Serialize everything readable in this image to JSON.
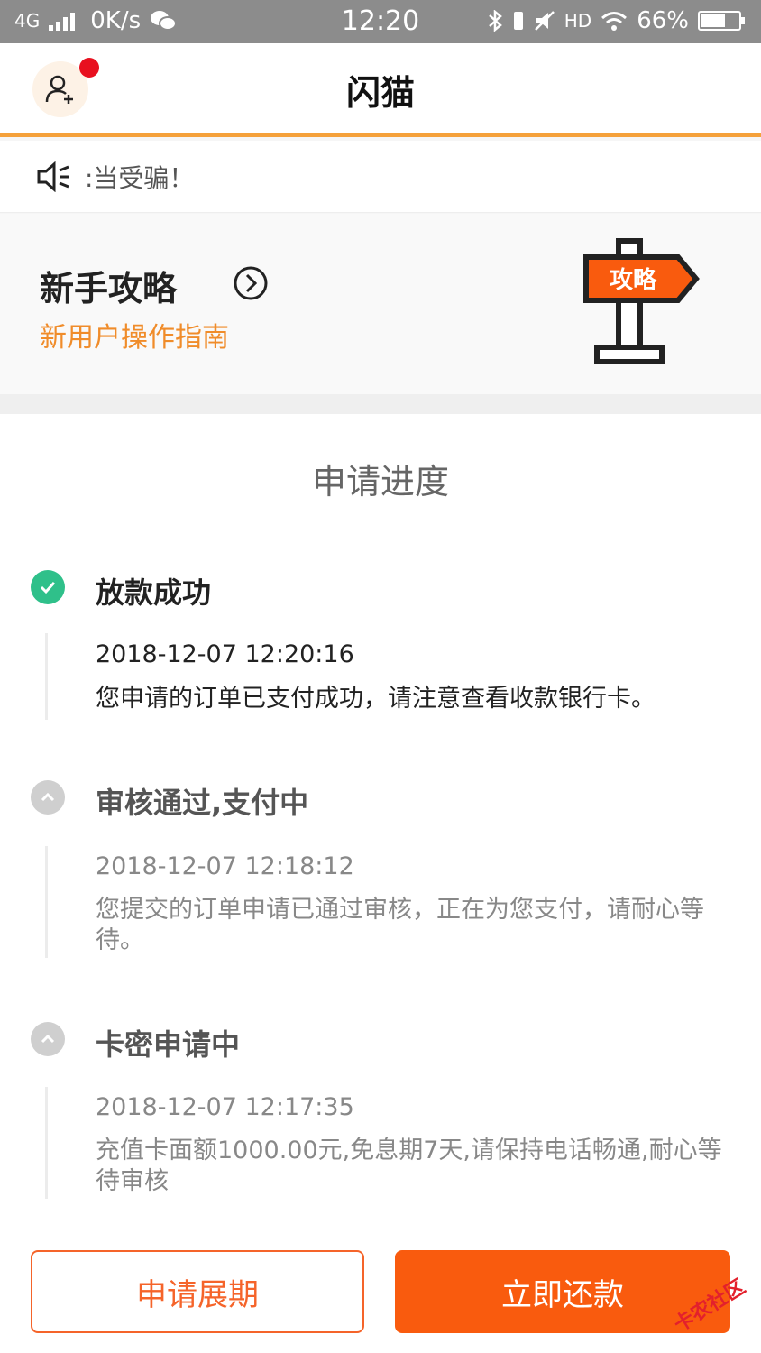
{
  "status_bar": {
    "network": "4G",
    "speed": "0K/s",
    "time": "12:20",
    "hd": "HD",
    "battery_percent": "66%",
    "battery_level": 0.66
  },
  "header": {
    "title": "闪猫",
    "has_notification_dot": true
  },
  "notice": {
    "text": ":当受骗！"
  },
  "guide": {
    "title": "新手攻略",
    "subtitle": "新用户操作指南",
    "sign_text": "攻略"
  },
  "progress": {
    "title": "申请进度",
    "steps": [
      {
        "status": "done",
        "title": "放款成功",
        "time": "2018-12-07 12:20:16",
        "desc": "您申请的订单已支付成功，请注意查看收款银行卡。"
      },
      {
        "status": "past",
        "title": "审核通过,支付中",
        "time": "2018-12-07 12:18:12",
        "desc": "您提交的订单申请已通过审核，正在为您支付，请耐心等待。"
      },
      {
        "status": "past",
        "title": "卡密申请中",
        "time": "2018-12-07 12:17:35",
        "desc": "充值卡面额1000.00元,免息期7天,请保持电话畅通,耐心等待审核"
      }
    ]
  },
  "actions": {
    "extend_label": "申请展期",
    "repay_label": "立即还款"
  },
  "watermark": {
    "text": "卡农社区"
  },
  "colors": {
    "accent_orange": "#f95b0e",
    "success_green": "#2fc08a",
    "header_underline": "#f5a13a",
    "notification_red": "#e8101f"
  }
}
